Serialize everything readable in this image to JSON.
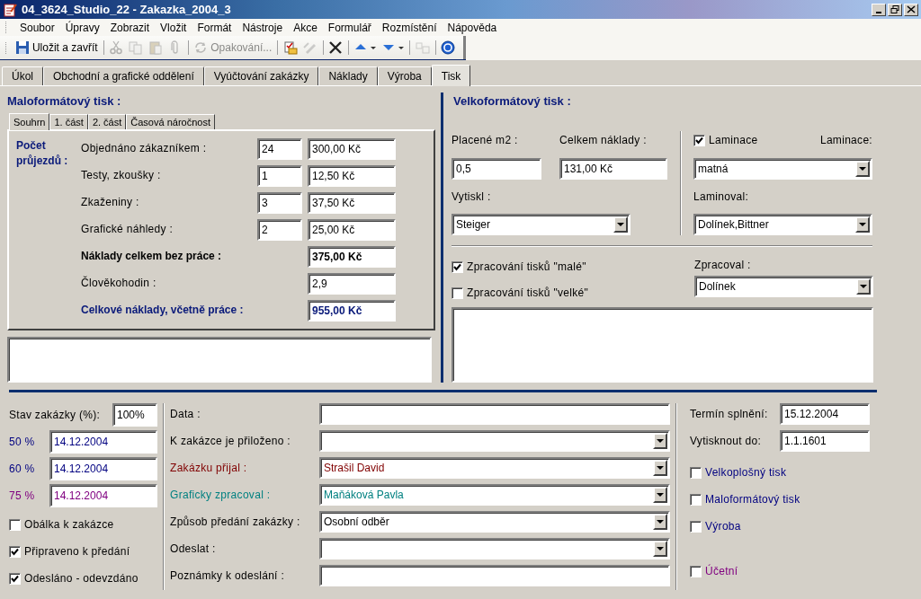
{
  "window": {
    "title": "04_3624_Studio_22 - Zakazka_2004_3"
  },
  "menu": [
    "Soubor",
    "Úpravy",
    "Zobrazit",
    "Vložit",
    "Formát",
    "Nástroje",
    "Akce",
    "Formulář",
    "Rozmístění",
    "Nápověda"
  ],
  "toolbar": [
    {
      "kind": "save",
      "label": "Uložit a zavřít",
      "disabled": false
    },
    {
      "kind": "separator"
    },
    {
      "kind": "cut",
      "disabled": true
    },
    {
      "kind": "copy",
      "disabled": true
    },
    {
      "kind": "paste",
      "disabled": true
    },
    {
      "kind": "attach",
      "disabled": true
    },
    {
      "kind": "separator"
    },
    {
      "kind": "recur",
      "label": "Opakování...",
      "disabled": true
    },
    {
      "kind": "separator"
    },
    {
      "kind": "assign",
      "disabled": false
    },
    {
      "kind": "pen",
      "disabled": true
    },
    {
      "kind": "separator"
    },
    {
      "kind": "delete",
      "disabled": false
    },
    {
      "kind": "separator"
    },
    {
      "kind": "up",
      "disabled": false
    },
    {
      "kind": "down",
      "disabled": false
    },
    {
      "kind": "separator"
    },
    {
      "kind": "translate",
      "disabled": true
    },
    {
      "kind": "separator"
    },
    {
      "kind": "help",
      "disabled": false
    }
  ],
  "tabs": [
    {
      "label": "Úkol",
      "selected": false
    },
    {
      "label": "Obchodní a grafické oddělení",
      "selected": false
    },
    {
      "label": "Vyúčtování zakázky",
      "selected": false
    },
    {
      "label": "Náklady",
      "selected": false
    },
    {
      "label": "Výroba",
      "selected": false
    },
    {
      "label": "Tisk",
      "selected": true
    }
  ],
  "small_print": {
    "title": "Maloformátový tisk :",
    "subtabs": [
      {
        "label": "Souhrn",
        "selected": true
      },
      {
        "label": "1. část",
        "selected": false
      },
      {
        "label": "2. část",
        "selected": false
      },
      {
        "label": "Časová náročnost",
        "selected": false
      }
    ],
    "group_label": "Počet průjezdů :",
    "rows": [
      {
        "kind": "count",
        "label": "Objednáno zákazníkem :",
        "count": "24",
        "amount": "300,00 Kč"
      },
      {
        "kind": "count",
        "label": "Testy, zkoušky :",
        "count": "1",
        "amount": "12,50 Kč"
      },
      {
        "kind": "count",
        "label": "Zkaženiny :",
        "count": "3",
        "amount": "37,50 Kč"
      },
      {
        "kind": "count",
        "label": "Grafické náhledy :",
        "count": "2",
        "amount": "25,00 Kč"
      },
      {
        "kind": "total",
        "label": "Náklady celkem bez práce :",
        "amount": "375,00 Kč"
      },
      {
        "kind": "plain",
        "label": "Člověkohodin :",
        "amount": "2,9"
      },
      {
        "kind": "grand",
        "label": "Celkové náklady, včetně práce :",
        "amount": "955,00 Kč"
      }
    ]
  },
  "large_print": {
    "title": "Velkoformátový tisk :",
    "paid_label": "Placené m2 :",
    "paid_value": "0,5",
    "cost_label": "Celkem náklady :",
    "cost_value": "131,00 Kč",
    "printed_by_label": "Vytiskl :",
    "printed_by_value": "Steiger",
    "lamination_check": {
      "label": "Laminace",
      "checked": true
    },
    "lamination_label": "Laminace:",
    "lamination_value": "matná",
    "laminated_by_label": "Laminoval:",
    "laminated_by_value": "Dolínek,Bittner",
    "processing_checks": [
      {
        "label": "Zpracování tisků \"malé\"",
        "checked": true
      },
      {
        "label": "Zpracování tisků \"velké\"",
        "checked": false
      }
    ],
    "processed_by_label": "Zpracoval :",
    "processed_by_value": "Dolínek"
  },
  "status": {
    "label": "Stav zakázky (%):",
    "value": "100%",
    "milestones": [
      {
        "label": "50 %",
        "value": "14.12.2004",
        "color": "#000080"
      },
      {
        "label": "60 %",
        "value": "14.12.2004",
        "color": "#000080"
      },
      {
        "label": "75 %",
        "value": "14.12.2004",
        "color": "#800080"
      }
    ],
    "checks": [
      {
        "label": "Obálka k zakázce",
        "checked": false
      },
      {
        "label": "Připraveno k předání",
        "checked": true
      },
      {
        "label": "Odesláno - odevzdáno",
        "checked": true
      }
    ]
  },
  "details": [
    {
      "kind": "text",
      "label": "Data :"
    },
    {
      "kind": "combo",
      "label": "K zakázce je přiloženo :"
    },
    {
      "kind": "combo",
      "label": "Zakázku přijal :",
      "value": "Strašil David",
      "color": "#800000"
    },
    {
      "kind": "combo",
      "label": "Graficky zpracoval :",
      "value": "Maňáková Pavla",
      "color": "#008080"
    },
    {
      "kind": "combo",
      "label": "Způsob předání zakázky :",
      "value": "Osobní odběr"
    },
    {
      "kind": "combo",
      "label": "Odeslat :"
    },
    {
      "kind": "text",
      "label": "Poznámky k odeslání :"
    }
  ],
  "deadlines": [
    {
      "label": "Termín splnění:",
      "value": "15.12.2004"
    },
    {
      "label": "Vytisknout do:",
      "value": "1.1.1601"
    }
  ],
  "departments": [
    {
      "label": "Velkoplošný tisk",
      "checked": false,
      "color": "#000080"
    },
    {
      "label": "Maloformátový tisk",
      "checked": false,
      "color": "#000080"
    },
    {
      "label": "Výroba",
      "checked": false,
      "color": "#000080"
    }
  ],
  "accounting": {
    "label": "Účetní",
    "checked": false,
    "color": "#800080"
  }
}
